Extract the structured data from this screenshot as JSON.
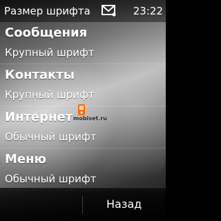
{
  "statusbar": {
    "title": "Размер шрифта",
    "time": "23:22",
    "message_icon": "envelope-icon"
  },
  "settings": [
    {
      "label": "Сообщения",
      "value": "Крупный шрифт"
    },
    {
      "label": "Контакты",
      "value": "Крупный шрифт"
    },
    {
      "label": "Интернет",
      "value": "Обычный шрифт"
    },
    {
      "label": "Меню",
      "value": "Обычный шрифт"
    }
  ],
  "watermark": {
    "text": "mobiset.ru",
    "logo_icon": "orange-device-logo-icon"
  },
  "softkeys": {
    "right_label": "Назад"
  },
  "colors": {
    "text": "#ffffff",
    "bar": "#000000",
    "watermark_accent": "#ff6a00"
  }
}
